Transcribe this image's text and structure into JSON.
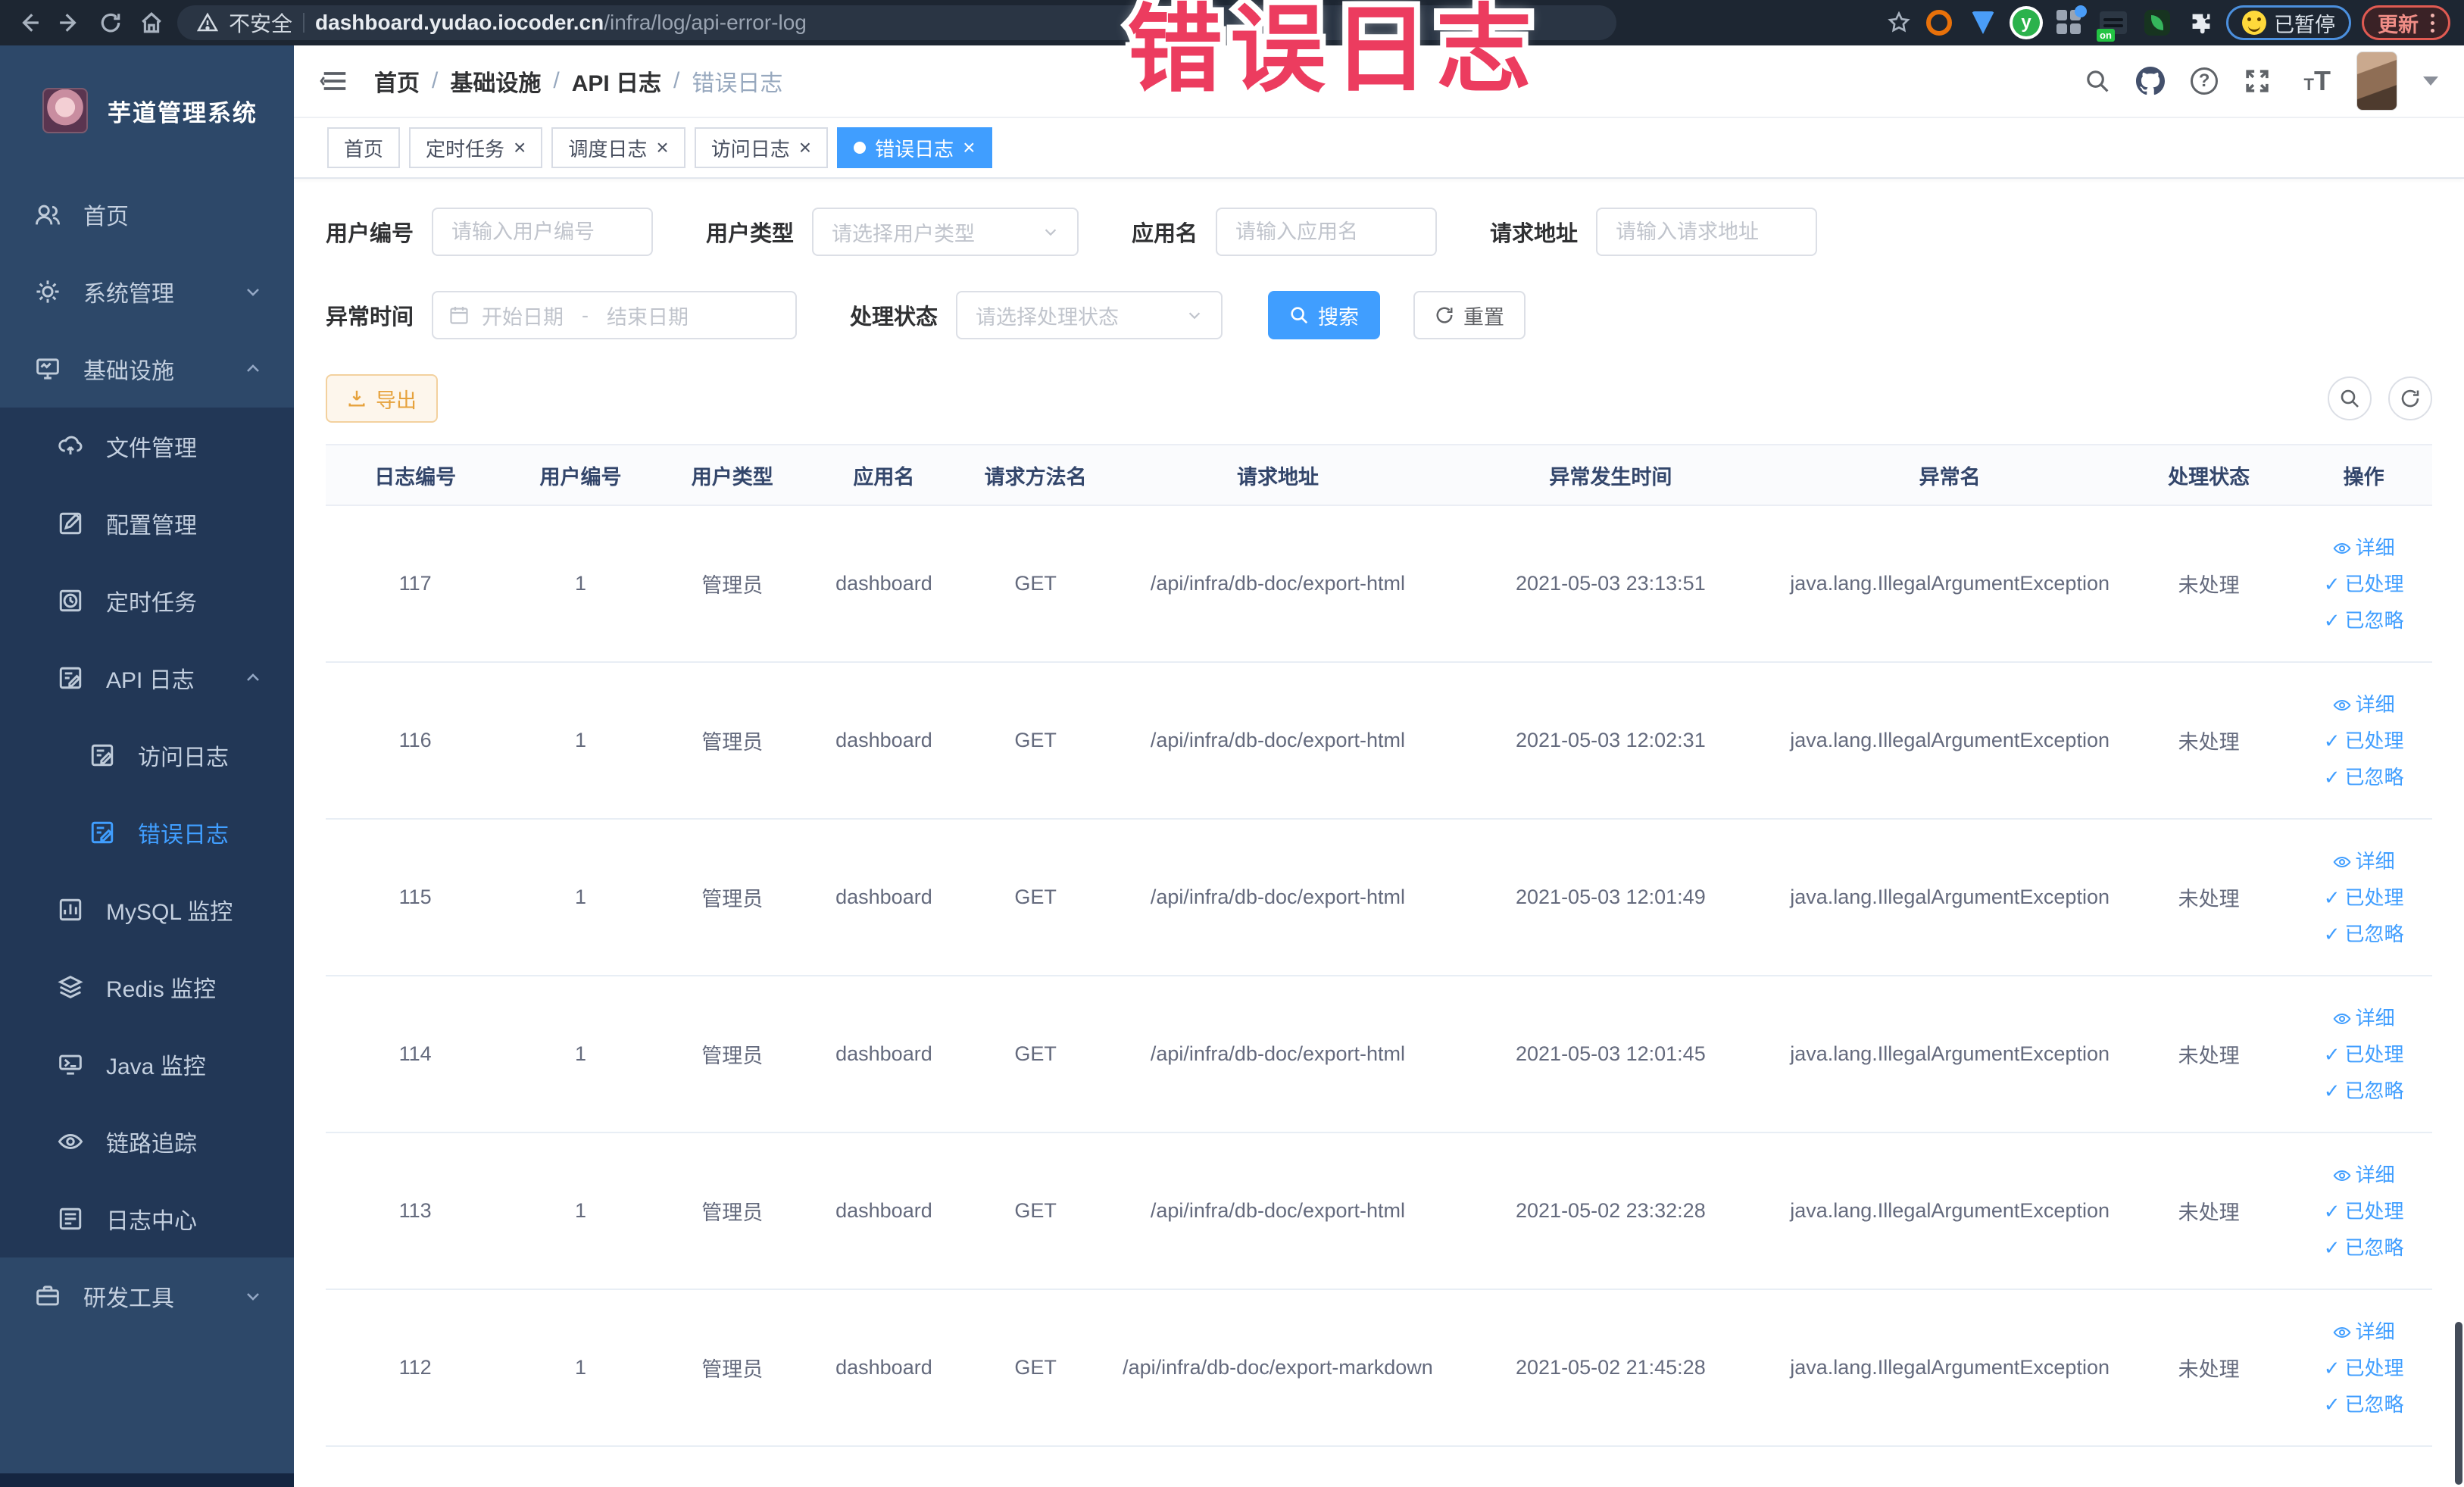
{
  "browser": {
    "security_label": "不安全",
    "url_domain": "dashboard.yudao.iocoder.cn",
    "url_path": "/infra/log/api-error-log",
    "paused_pill_label": "已暂停",
    "update_pill_label": "更新"
  },
  "overlay": {
    "title": "错误日志"
  },
  "colors": {
    "accent": "#409eff",
    "overlay_red": "#ec3c5f",
    "warning": "#e6a23c",
    "sidebar_bg": "#2d4869",
    "submenu_bg": "#223756"
  },
  "sidebar": {
    "logo_title": "芋道管理系统",
    "items": [
      {
        "label": "首页"
      },
      {
        "label": "系统管理"
      },
      {
        "label": "基础设施"
      },
      {
        "label": "文件管理"
      },
      {
        "label": "配置管理"
      },
      {
        "label": "定时任务"
      },
      {
        "label": "API 日志"
      },
      {
        "label": "访问日志"
      },
      {
        "label": "错误日志"
      },
      {
        "label": "MySQL 监控"
      },
      {
        "label": "Redis 监控"
      },
      {
        "label": "Java 监控"
      },
      {
        "label": "链路追踪"
      },
      {
        "label": "日志中心"
      },
      {
        "label": "研发工具"
      }
    ]
  },
  "header": {
    "breadcrumb": [
      "首页",
      "基础设施",
      "API 日志",
      "错误日志"
    ]
  },
  "tabs": [
    {
      "label": "首页"
    },
    {
      "label": "定时任务"
    },
    {
      "label": "调度日志"
    },
    {
      "label": "访问日志"
    },
    {
      "label": "错误日志"
    }
  ],
  "filters": {
    "user_id": {
      "label": "用户编号",
      "placeholder": "请输入用户编号"
    },
    "user_type": {
      "label": "用户类型",
      "placeholder": "请选择用户类型"
    },
    "app_name": {
      "label": "应用名",
      "placeholder": "请输入应用名"
    },
    "request_url": {
      "label": "请求地址",
      "placeholder": "请输入请求地址"
    },
    "exception_time": {
      "label": "异常时间",
      "start_placeholder": "开始日期",
      "separator": "-",
      "end_placeholder": "结束日期"
    },
    "process_status": {
      "label": "处理状态",
      "placeholder": "请选择处理状态"
    },
    "search_label": "搜索",
    "reset_label": "重置"
  },
  "toolbar": {
    "export_label": "导出"
  },
  "table": {
    "columns": [
      "日志编号",
      "用户编号",
      "用户类型",
      "应用名",
      "请求方法名",
      "请求地址",
      "异常发生时间",
      "异常名",
      "处理状态",
      "操作"
    ],
    "action_labels": [
      "详细",
      "已处理",
      "已忽略"
    ],
    "rows": [
      {
        "id": "117",
        "user_id": "1",
        "user_type": "管理员",
        "app": "dashboard",
        "method": "GET",
        "url": "/api/infra/db-doc/export-html",
        "time": "2021-05-03 23:13:51",
        "exception": "java.lang.IllegalArgumentException",
        "status": "未处理"
      },
      {
        "id": "116",
        "user_id": "1",
        "user_type": "管理员",
        "app": "dashboard",
        "method": "GET",
        "url": "/api/infra/db-doc/export-html",
        "time": "2021-05-03 12:02:31",
        "exception": "java.lang.IllegalArgumentException",
        "status": "未处理"
      },
      {
        "id": "115",
        "user_id": "1",
        "user_type": "管理员",
        "app": "dashboard",
        "method": "GET",
        "url": "/api/infra/db-doc/export-html",
        "time": "2021-05-03 12:01:49",
        "exception": "java.lang.IllegalArgumentException",
        "status": "未处理"
      },
      {
        "id": "114",
        "user_id": "1",
        "user_type": "管理员",
        "app": "dashboard",
        "method": "GET",
        "url": "/api/infra/db-doc/export-html",
        "time": "2021-05-03 12:01:45",
        "exception": "java.lang.IllegalArgumentException",
        "status": "未处理"
      },
      {
        "id": "113",
        "user_id": "1",
        "user_type": "管理员",
        "app": "dashboard",
        "method": "GET",
        "url": "/api/infra/db-doc/export-html",
        "time": "2021-05-02 23:32:28",
        "exception": "java.lang.IllegalArgumentException",
        "status": "未处理"
      },
      {
        "id": "112",
        "user_id": "1",
        "user_type": "管理员",
        "app": "dashboard",
        "method": "GET",
        "url": "/api/infra/db-doc/export-markdown",
        "time": "2021-05-02 21:45:28",
        "exception": "java.lang.IllegalArgumentException",
        "status": "未处理"
      }
    ]
  }
}
